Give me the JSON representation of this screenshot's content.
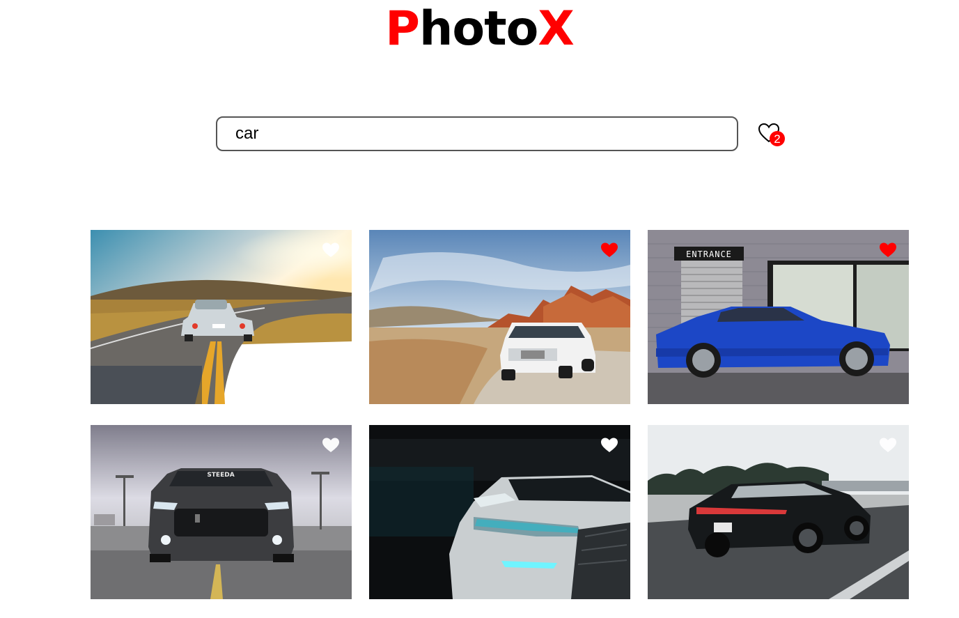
{
  "logo": {
    "first_letter": "P",
    "middle": "hoto",
    "last_letter": "X",
    "accent_color": "#ff0000"
  },
  "search": {
    "value": "car",
    "placeholder": ""
  },
  "favorites": {
    "icon": "heart-outline-icon",
    "count": "2"
  },
  "photos": [
    {
      "subject": "silver sports car on winding road at sunset",
      "liked": false
    },
    {
      "subject": "white SUV in red rock desert",
      "liked": true
    },
    {
      "subject": "blue coupe in front of entrance wall",
      "liked": true,
      "sign_text": "ENTRANCE"
    },
    {
      "subject": "dark grey muscle car front view",
      "liked": false,
      "windshield_text": "STEEDA"
    },
    {
      "subject": "white car with blue headlights in dark garage",
      "liked": false
    },
    {
      "subject": "black sedan driving on highway",
      "liked": false
    }
  ],
  "colors": {
    "liked_heart": "#ff0000",
    "unliked_heart": "#ffffff"
  }
}
